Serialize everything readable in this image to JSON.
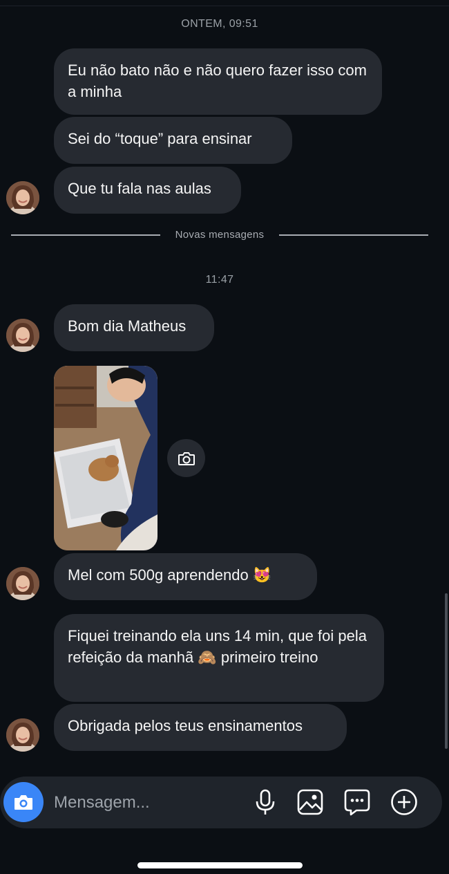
{
  "thread": {
    "timestamp_yesterday": "ONTEM, 09:51",
    "divider_label": "Novas mensagens",
    "timestamp_today": "11:47"
  },
  "messages": [
    {
      "text": "Eu não bato não e não quero fazer isso com a minha"
    },
    {
      "text": "Sei do “toque” para ensinar"
    },
    {
      "text": "Que tu fala nas aulas"
    },
    {
      "text": "Bom dia Matheus"
    },
    {
      "text": "Mel com 500g aprendendo 😻"
    },
    {
      "text": "Fiquei treinando ela uns 14 min, que foi pela refeição da manhã 🙈 primeiro treino"
    },
    {
      "text": "Obrigada pelos teus ensinamentos"
    }
  ],
  "composer": {
    "placeholder": "Mensagem..."
  },
  "colors": {
    "background": "#0b0f14",
    "bubble": "#262a31",
    "accent": "#3a86f7"
  },
  "icons": [
    "camera-icon",
    "microphone-icon",
    "gallery-icon",
    "sticker-icon",
    "plus-circle-icon"
  ]
}
